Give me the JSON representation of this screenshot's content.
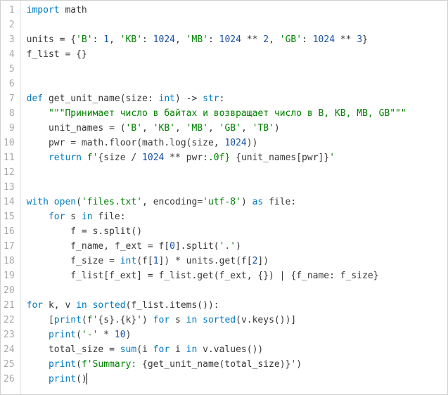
{
  "gutter": {
    "line_numbers": [
      "1",
      "2",
      "3",
      "4",
      "5",
      "6",
      "7",
      "8",
      "9",
      "10",
      "11",
      "12",
      "13",
      "14",
      "15",
      "16",
      "17",
      "18",
      "19",
      "20",
      "21",
      "22",
      "23",
      "24",
      "25",
      "26"
    ]
  },
  "code": {
    "raw_lines": [
      "import math",
      "",
      "units = {'B': 1, 'KB': 1024, 'MB': 1024 ** 2, 'GB': 1024 ** 3}",
      "f_list = {}",
      "",
      "",
      "def get_unit_name(size: int) -> str:",
      "    \"\"\"Принимает число в байтах и возвращает число в B, KB, MB, GB\"\"\"",
      "    unit_names = ('B', 'KB', 'MB', 'GB', 'TB')",
      "    pwr = math.floor(math.log(size, 1024))",
      "    return f'{size / 1024 ** pwr:.0f} {unit_names[pwr]}'",
      "",
      "",
      "with open('files.txt', encoding='utf-8') as file:",
      "    for s in file:",
      "        f = s.split()",
      "        f_name, f_ext = f[0].split('.')",
      "        f_size = int(f[1]) * units.get(f[2])",
      "        f_list[f_ext] = f_list.get(f_ext, {}) | {f_name: f_size}",
      "",
      "for k, v in sorted(f_list.items()):",
      "    [print(f'{s}.{k}') for s in sorted(v.keys())]",
      "    print('-' * 10)",
      "    total_size = sum(i for i in v.values())",
      "    print(f'Summary: {get_unit_name(total_size)}')",
      "    print()"
    ],
    "tokens": [
      [
        {
          "t": "import",
          "c": "tok-kw"
        },
        {
          "t": " math",
          "c": "tok-name"
        }
      ],
      [],
      [
        {
          "t": "units ",
          "c": "tok-name"
        },
        {
          "t": "=",
          "c": "tok-op"
        },
        {
          "t": " {",
          "c": "tok-op"
        },
        {
          "t": "'B'",
          "c": "tok-str"
        },
        {
          "t": ": ",
          "c": "tok-op"
        },
        {
          "t": "1",
          "c": "tok-num"
        },
        {
          "t": ", ",
          "c": "tok-op"
        },
        {
          "t": "'KB'",
          "c": "tok-str"
        },
        {
          "t": ": ",
          "c": "tok-op"
        },
        {
          "t": "1024",
          "c": "tok-num"
        },
        {
          "t": ", ",
          "c": "tok-op"
        },
        {
          "t": "'MB'",
          "c": "tok-str"
        },
        {
          "t": ": ",
          "c": "tok-op"
        },
        {
          "t": "1024",
          "c": "tok-num"
        },
        {
          "t": " ** ",
          "c": "tok-op"
        },
        {
          "t": "2",
          "c": "tok-num"
        },
        {
          "t": ", ",
          "c": "tok-op"
        },
        {
          "t": "'GB'",
          "c": "tok-str"
        },
        {
          "t": ": ",
          "c": "tok-op"
        },
        {
          "t": "1024",
          "c": "tok-num"
        },
        {
          "t": " ** ",
          "c": "tok-op"
        },
        {
          "t": "3",
          "c": "tok-num"
        },
        {
          "t": "}",
          "c": "tok-op"
        }
      ],
      [
        {
          "t": "f_list ",
          "c": "tok-name"
        },
        {
          "t": "=",
          "c": "tok-op"
        },
        {
          "t": " {}",
          "c": "tok-op"
        }
      ],
      [],
      [],
      [
        {
          "t": "def",
          "c": "tok-kw"
        },
        {
          "t": " ",
          "c": ""
        },
        {
          "t": "get_unit_name",
          "c": "tok-defname"
        },
        {
          "t": "(size: ",
          "c": "tok-name"
        },
        {
          "t": "int",
          "c": "tok-type"
        },
        {
          "t": ") -> ",
          "c": "tok-name"
        },
        {
          "t": "str",
          "c": "tok-type"
        },
        {
          "t": ":",
          "c": "tok-op"
        }
      ],
      [
        {
          "t": "    ",
          "c": ""
        },
        {
          "t": "\"\"\"Принимает число в байтах и возвращает число в B, KB, MB, GB\"\"\"",
          "c": "tok-str"
        }
      ],
      [
        {
          "t": "    unit_names ",
          "c": "tok-name"
        },
        {
          "t": "=",
          "c": "tok-op"
        },
        {
          "t": " (",
          "c": "tok-op"
        },
        {
          "t": "'B'",
          "c": "tok-str"
        },
        {
          "t": ", ",
          "c": "tok-op"
        },
        {
          "t": "'KB'",
          "c": "tok-str"
        },
        {
          "t": ", ",
          "c": "tok-op"
        },
        {
          "t": "'MB'",
          "c": "tok-str"
        },
        {
          "t": ", ",
          "c": "tok-op"
        },
        {
          "t": "'GB'",
          "c": "tok-str"
        },
        {
          "t": ", ",
          "c": "tok-op"
        },
        {
          "t": "'TB'",
          "c": "tok-str"
        },
        {
          "t": ")",
          "c": "tok-op"
        }
      ],
      [
        {
          "t": "    pwr ",
          "c": "tok-name"
        },
        {
          "t": "=",
          "c": "tok-op"
        },
        {
          "t": " math.floor(math.log(size, ",
          "c": "tok-name"
        },
        {
          "t": "1024",
          "c": "tok-num"
        },
        {
          "t": "))",
          "c": "tok-name"
        }
      ],
      [
        {
          "t": "    ",
          "c": ""
        },
        {
          "t": "return",
          "c": "tok-kw"
        },
        {
          "t": " ",
          "c": ""
        },
        {
          "t": "f'",
          "c": "tok-str"
        },
        {
          "t": "{size / ",
          "c": "tok-name"
        },
        {
          "t": "1024",
          "c": "tok-num"
        },
        {
          "t": " ** pwr",
          "c": "tok-name"
        },
        {
          "t": ":.0f}",
          "c": "tok-str"
        },
        {
          "t": " ",
          "c": "tok-str"
        },
        {
          "t": "{unit_names[pwr]}",
          "c": "tok-name"
        },
        {
          "t": "'",
          "c": "tok-str"
        }
      ],
      [],
      [],
      [
        {
          "t": "with",
          "c": "tok-kw"
        },
        {
          "t": " ",
          "c": ""
        },
        {
          "t": "open",
          "c": "tok-fn"
        },
        {
          "t": "(",
          "c": "tok-op"
        },
        {
          "t": "'files.txt'",
          "c": "tok-str"
        },
        {
          "t": ", ",
          "c": "tok-op"
        },
        {
          "t": "encoding",
          "c": "tok-name"
        },
        {
          "t": "=",
          "c": "tok-op"
        },
        {
          "t": "'utf-8'",
          "c": "tok-str"
        },
        {
          "t": ") ",
          "c": "tok-op"
        },
        {
          "t": "as",
          "c": "tok-kw"
        },
        {
          "t": " file:",
          "c": "tok-name"
        }
      ],
      [
        {
          "t": "    ",
          "c": ""
        },
        {
          "t": "for",
          "c": "tok-kw"
        },
        {
          "t": " s ",
          "c": "tok-name"
        },
        {
          "t": "in",
          "c": "tok-kw"
        },
        {
          "t": " file:",
          "c": "tok-name"
        }
      ],
      [
        {
          "t": "        f ",
          "c": "tok-name"
        },
        {
          "t": "=",
          "c": "tok-op"
        },
        {
          "t": " s.split()",
          "c": "tok-name"
        }
      ],
      [
        {
          "t": "        f_name, f_ext ",
          "c": "tok-name"
        },
        {
          "t": "=",
          "c": "tok-op"
        },
        {
          "t": " f[",
          "c": "tok-name"
        },
        {
          "t": "0",
          "c": "tok-num"
        },
        {
          "t": "].split(",
          "c": "tok-name"
        },
        {
          "t": "'.'",
          "c": "tok-str"
        },
        {
          "t": ")",
          "c": "tok-name"
        }
      ],
      [
        {
          "t": "        f_size ",
          "c": "tok-name"
        },
        {
          "t": "=",
          "c": "tok-op"
        },
        {
          "t": " ",
          "c": ""
        },
        {
          "t": "int",
          "c": "tok-fn"
        },
        {
          "t": "(f[",
          "c": "tok-name"
        },
        {
          "t": "1",
          "c": "tok-num"
        },
        {
          "t": "]) * units.get(f[",
          "c": "tok-name"
        },
        {
          "t": "2",
          "c": "tok-num"
        },
        {
          "t": "])",
          "c": "tok-name"
        }
      ],
      [
        {
          "t": "        f_list[f_ext] ",
          "c": "tok-name"
        },
        {
          "t": "=",
          "c": "tok-op"
        },
        {
          "t": " f_list.get(f_ext, {}) | {f_name: f_size}",
          "c": "tok-name"
        }
      ],
      [],
      [
        {
          "t": "for",
          "c": "tok-kw"
        },
        {
          "t": " k, v ",
          "c": "tok-name"
        },
        {
          "t": "in",
          "c": "tok-kw"
        },
        {
          "t": " ",
          "c": ""
        },
        {
          "t": "sorted",
          "c": "tok-fn"
        },
        {
          "t": "(f_list.items()):",
          "c": "tok-name"
        }
      ],
      [
        {
          "t": "    [",
          "c": "tok-name"
        },
        {
          "t": "print",
          "c": "tok-fn"
        },
        {
          "t": "(",
          "c": "tok-name"
        },
        {
          "t": "f'",
          "c": "tok-str"
        },
        {
          "t": "{s}",
          "c": "tok-name"
        },
        {
          "t": ".",
          "c": "tok-str"
        },
        {
          "t": "{k}",
          "c": "tok-name"
        },
        {
          "t": "'",
          "c": "tok-str"
        },
        {
          "t": ") ",
          "c": "tok-name"
        },
        {
          "t": "for",
          "c": "tok-kw"
        },
        {
          "t": " s ",
          "c": "tok-name"
        },
        {
          "t": "in",
          "c": "tok-kw"
        },
        {
          "t": " ",
          "c": ""
        },
        {
          "t": "sorted",
          "c": "tok-fn"
        },
        {
          "t": "(v.keys())]",
          "c": "tok-name"
        }
      ],
      [
        {
          "t": "    ",
          "c": ""
        },
        {
          "t": "print",
          "c": "tok-fn"
        },
        {
          "t": "(",
          "c": "tok-name"
        },
        {
          "t": "'-'",
          "c": "tok-str"
        },
        {
          "t": " * ",
          "c": "tok-op"
        },
        {
          "t": "10",
          "c": "tok-num"
        },
        {
          "t": ")",
          "c": "tok-name"
        }
      ],
      [
        {
          "t": "    total_size ",
          "c": "tok-name"
        },
        {
          "t": "=",
          "c": "tok-op"
        },
        {
          "t": " ",
          "c": ""
        },
        {
          "t": "sum",
          "c": "tok-fn"
        },
        {
          "t": "(i ",
          "c": "tok-name"
        },
        {
          "t": "for",
          "c": "tok-kw"
        },
        {
          "t": " i ",
          "c": "tok-name"
        },
        {
          "t": "in",
          "c": "tok-kw"
        },
        {
          "t": " v.values())",
          "c": "tok-name"
        }
      ],
      [
        {
          "t": "    ",
          "c": ""
        },
        {
          "t": "print",
          "c": "tok-fn"
        },
        {
          "t": "(",
          "c": "tok-name"
        },
        {
          "t": "f'Summary: ",
          "c": "tok-str"
        },
        {
          "t": "{get_unit_name(total_size)}",
          "c": "tok-name"
        },
        {
          "t": "'",
          "c": "tok-str"
        },
        {
          "t": ")",
          "c": "tok-name"
        }
      ],
      [
        {
          "t": "    ",
          "c": ""
        },
        {
          "t": "print",
          "c": "tok-fn"
        },
        {
          "t": "()",
          "c": "tok-name"
        }
      ]
    ],
    "cursor_line": 26
  }
}
